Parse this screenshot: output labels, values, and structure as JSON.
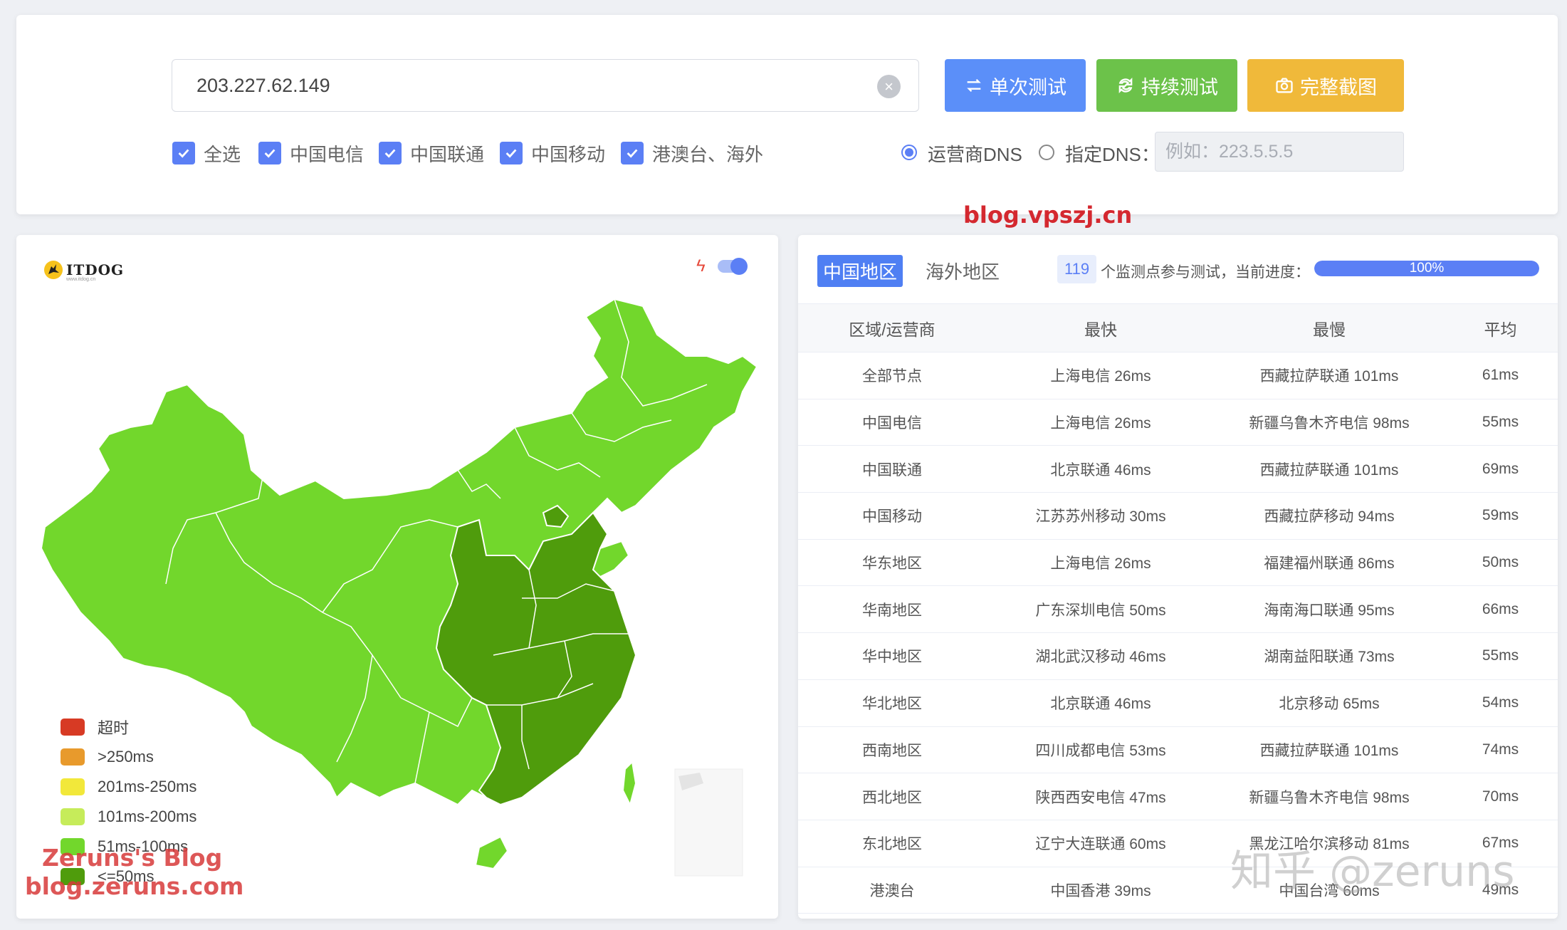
{
  "search": {
    "ip_value": "203.227.62.149",
    "clear_icon": "close-circle-icon"
  },
  "buttons": {
    "single_test": "单次测试",
    "continuous_test": "持续测试",
    "full_screenshot": "完整截图",
    "colors": {
      "single": "#5b8ff9",
      "continuous": "#6cc24a",
      "screenshot": "#f0b93a"
    }
  },
  "filters": [
    {
      "label": "全选",
      "checked": true
    },
    {
      "label": "中国电信",
      "checked": true
    },
    {
      "label": "中国联通",
      "checked": true
    },
    {
      "label": "中国移动",
      "checked": true
    },
    {
      "label": "港澳台、海外",
      "checked": true
    }
  ],
  "dns": {
    "option_isp": "运营商DNS",
    "option_custom": "指定DNS：",
    "selected": "运营商DNS",
    "custom_placeholder": "例如：223.5.5.5"
  },
  "watermarks": {
    "top": "blog.vpszj.cn",
    "bottom_left_line1": "Zeruns's Blog",
    "bottom_left_line2": "blog.zeruns.com",
    "bottom_right": "知乎 @zeruns"
  },
  "map": {
    "logo_text": "ITDOG",
    "logo_sub": "www.itdog.cn",
    "legend": [
      {
        "label": "超时",
        "color": "#d73a24"
      },
      {
        "label": ">250ms",
        "color": "#e89a2c"
      },
      {
        "label": "201ms-250ms",
        "color": "#f2e83a"
      },
      {
        "label": "101ms-200ms",
        "color": "#c6ec5a"
      },
      {
        "label": "51ms-100ms",
        "color": "#72d72c"
      },
      {
        "label": "<=50ms",
        "color": "#4f9c0c"
      }
    ]
  },
  "results": {
    "tabs": [
      {
        "label": "中国地区",
        "active": true
      },
      {
        "label": "海外地区",
        "active": false
      }
    ],
    "node_count": "119",
    "count_text": "个监测点参与测试，当前进度：",
    "progress_fraction": 1.0,
    "progress_label": "100%",
    "columns": [
      "区域/运营商",
      "最快",
      "最慢",
      "平均"
    ],
    "rows": [
      [
        "全部节点",
        "上海电信 26ms",
        "西藏拉萨联通 101ms",
        "61ms"
      ],
      [
        "中国电信",
        "上海电信 26ms",
        "新疆乌鲁木齐电信 98ms",
        "55ms"
      ],
      [
        "中国联通",
        "北京联通 46ms",
        "西藏拉萨联通 101ms",
        "69ms"
      ],
      [
        "中国移动",
        "江苏苏州移动 30ms",
        "西藏拉萨移动 94ms",
        "59ms"
      ],
      [
        "华东地区",
        "上海电信 26ms",
        "福建福州联通 86ms",
        "50ms"
      ],
      [
        "华南地区",
        "广东深圳电信 50ms",
        "海南海口联通 95ms",
        "66ms"
      ],
      [
        "华中地区",
        "湖北武汉移动 46ms",
        "湖南益阳联通 73ms",
        "55ms"
      ],
      [
        "华北地区",
        "北京联通 46ms",
        "北京移动 65ms",
        "54ms"
      ],
      [
        "西南地区",
        "四川成都电信 53ms",
        "西藏拉萨联通 101ms",
        "74ms"
      ],
      [
        "西北地区",
        "陕西西安电信 47ms",
        "新疆乌鲁木齐电信 98ms",
        "70ms"
      ],
      [
        "东北地区",
        "辽宁大连联通 60ms",
        "黑龙江哈尔滨移动 81ms",
        "67ms"
      ],
      [
        "港澳台",
        "中国香港 39ms",
        "中国台湾 60ms",
        "49ms"
      ]
    ]
  }
}
